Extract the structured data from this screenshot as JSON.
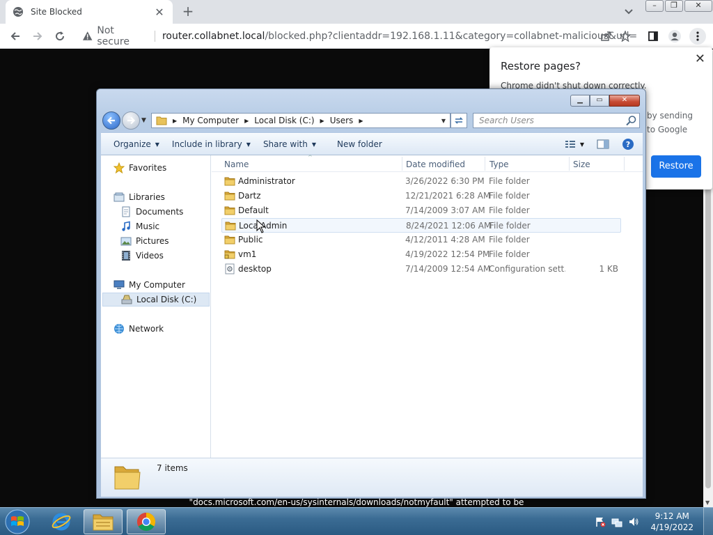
{
  "browser": {
    "tab_title": "Site Blocked",
    "address_warning": "Not secure",
    "url_host": "router.collabnet.local",
    "url_rest": "/blocked.php?clientaddr=192.168.1.11&category=collabnet-malicious&url=d..."
  },
  "restore_bubble": {
    "title": "Restore pages?",
    "message": "Chrome didn't shut down correctly.",
    "message_tail_1": "by sending",
    "message_tail_2": "to Google",
    "button": "Restore"
  },
  "explorer": {
    "breadcrumbs": [
      "My Computer",
      "Local Disk (C:)",
      "Users"
    ],
    "search_placeholder": "Search Users",
    "commands": {
      "organize": "Organize",
      "include": "Include in library",
      "share": "Share with",
      "new_folder": "New folder"
    },
    "nav": {
      "favorites": "Favorites",
      "libraries": "Libraries",
      "documents": "Documents",
      "music": "Music",
      "pictures": "Pictures",
      "videos": "Videos",
      "my_computer": "My Computer",
      "local_disk": "Local Disk (C:)",
      "network": "Network"
    },
    "columns": {
      "name": "Name",
      "date": "Date modified",
      "type": "Type",
      "size": "Size"
    },
    "files": [
      {
        "name": "Administrator",
        "date": "3/26/2022 6:30 PM",
        "type": "File folder",
        "size": ""
      },
      {
        "name": "Dartz",
        "date": "12/21/2021 6:28 AM",
        "type": "File folder",
        "size": ""
      },
      {
        "name": "Default",
        "date": "7/14/2009 3:07 AM",
        "type": "File folder",
        "size": ""
      },
      {
        "name": "LocalAdmin",
        "date": "8/24/2021 12:06 AM",
        "type": "File folder",
        "size": ""
      },
      {
        "name": "Public",
        "date": "4/12/2011 4:28 AM",
        "type": "File folder",
        "size": ""
      },
      {
        "name": "vm1",
        "date": "4/19/2022 12:54 PM",
        "type": "File folder",
        "size": ""
      },
      {
        "name": "desktop",
        "date": "7/14/2009 12:54 AM",
        "type": "Configuration sett...",
        "size": "1 KB"
      }
    ],
    "status_count": "7 items"
  },
  "ticker_text": "\"docs.microsoft.com/en-us/sysinternals/downloads/notmyfault\" attempted to be",
  "taskbar": {
    "time": "9:12 AM",
    "date": "4/19/2022"
  },
  "colors": {
    "chrome_blue": "#1a73e8",
    "taskbar": "#3b6c94",
    "explorer_frame": "#b8cde6"
  }
}
